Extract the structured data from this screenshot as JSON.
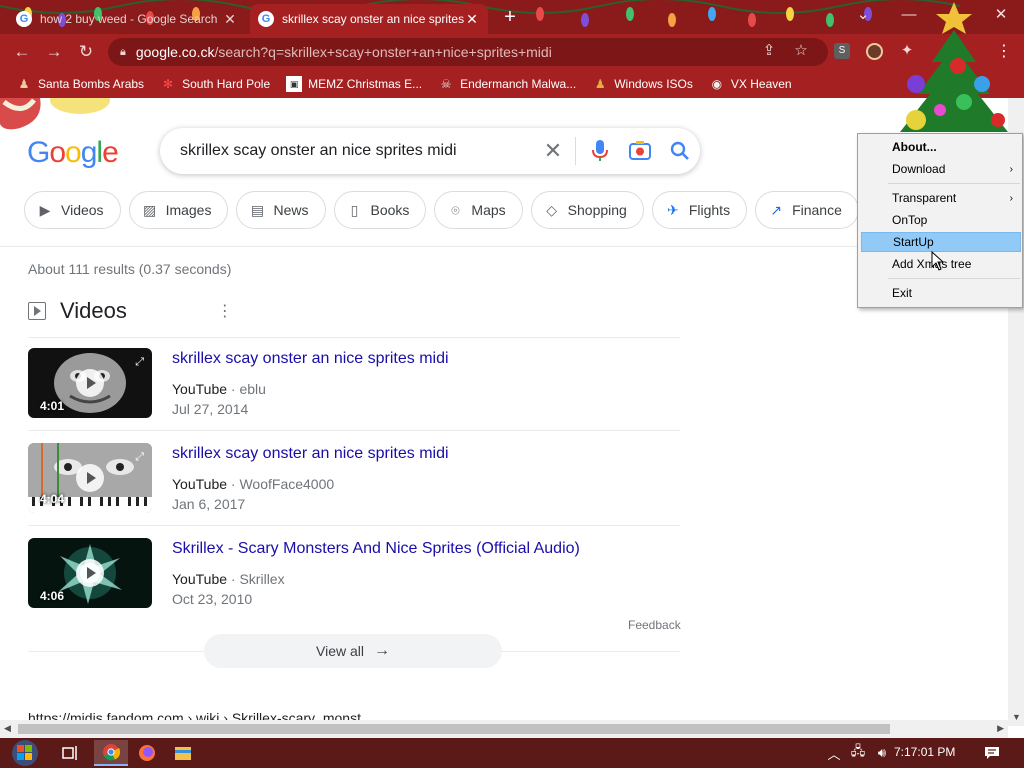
{
  "browser": {
    "tabs": [
      {
        "title": "how 2 buy weed - Google Search",
        "active": false
      },
      {
        "title": "skrillex scay onster an nice sprites midi - Google Search",
        "active": true
      }
    ],
    "url_host": "google.co.ck",
    "url_path": "/search?q=skrillex+scay+onster+an+nice+sprites+midi",
    "ext_label": "S",
    "bookmarks": [
      {
        "label": "Santa Bombs Arabs",
        "icon": "figure-icon"
      },
      {
        "label": "South Hard Pole",
        "icon": "snowflake-icon"
      },
      {
        "label": "MEMZ Christmas E...",
        "icon": "window-icon"
      },
      {
        "label": "Endermanch Malwa...",
        "icon": "skull-icon"
      },
      {
        "label": "Windows ISOs",
        "icon": "figure-icon"
      },
      {
        "label": "VX Heaven",
        "icon": "globe-icon"
      }
    ],
    "accent_color": "#a52020"
  },
  "search": {
    "query": "skrillex scay onster an nice sprites midi",
    "chips": [
      {
        "label": "Videos",
        "icon": "video-icon"
      },
      {
        "label": "Images",
        "icon": "image-icon"
      },
      {
        "label": "News",
        "icon": "news-icon"
      },
      {
        "label": "Books",
        "icon": "book-icon"
      },
      {
        "label": "Maps",
        "icon": "map-pin-icon"
      },
      {
        "label": "Shopping",
        "icon": "tag-icon"
      },
      {
        "label": "Flights",
        "icon": "plane-icon"
      },
      {
        "label": "Finance",
        "icon": "chart-icon"
      }
    ],
    "stats": "About 111 results (0.37 seconds)"
  },
  "videos": {
    "heading": "Videos",
    "items": [
      {
        "title": "skrillex scay onster an nice sprites midi",
        "source": "YouTube",
        "channel": "eblu",
        "date": "Jul 27, 2014",
        "duration": "4:01"
      },
      {
        "title": "skrillex scay onster an nice sprites midi",
        "source": "YouTube",
        "channel": "WoofFace4000",
        "date": "Jan 6, 2017",
        "duration": "4:04"
      },
      {
        "title": "Skrillex - Scary Monsters And Nice Sprites (Official Audio)",
        "source": "YouTube",
        "channel": "Skrillex",
        "date": "Oct 23, 2010",
        "duration": "4:06"
      }
    ],
    "feedback": "Feedback",
    "view_all": "View all"
  },
  "next_result": "https://midis.fandom.com › wiki › Skrillex-scary_monst...",
  "context_menu": {
    "items": [
      {
        "label": "About...",
        "bold": true,
        "submenu": false
      },
      {
        "label": "Download",
        "bold": false,
        "submenu": true
      },
      {
        "label": "Transparent",
        "bold": false,
        "submenu": true
      },
      {
        "label": "OnTop",
        "bold": false,
        "submenu": false
      },
      {
        "label": "StartUp",
        "bold": false,
        "submenu": false,
        "highlighted": true
      },
      {
        "label": "Add Xmas tree",
        "bold": false,
        "submenu": false
      },
      {
        "label": "Exit",
        "bold": false,
        "submenu": false
      }
    ]
  },
  "taskbar": {
    "clock": "7:17:01 PM"
  }
}
